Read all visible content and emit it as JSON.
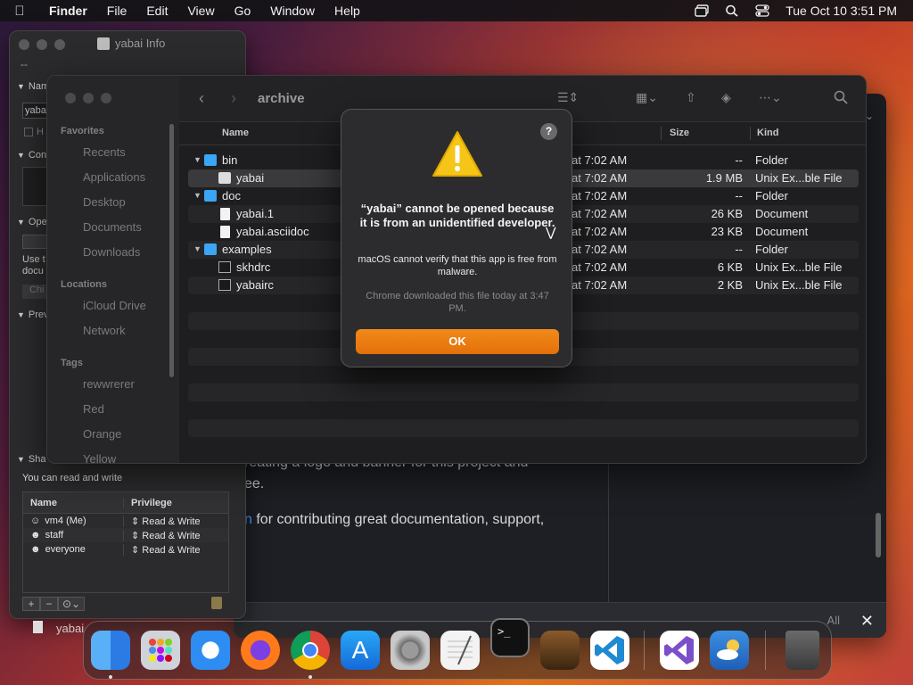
{
  "menubar": {
    "app": "Finder",
    "items": [
      "File",
      "Edit",
      "View",
      "Go",
      "Window",
      "Help"
    ],
    "clock": "Tue Oct 10  3:51 PM"
  },
  "doc_window": {
    "line1": "reating a logo and banner for this project and",
    "line2": "ee.",
    "line3_link": "n",
    "line3_text": " for contributing great documentation, support,",
    "all_label": "All"
  },
  "info_window": {
    "title": "yabai Info",
    "dash": "--",
    "sections": [
      "Nam",
      "yaba",
      "H",
      "Con",
      "Ope",
      "Use t",
      "docu",
      "Chi",
      "Prev",
      "Sha"
    ],
    "share_text": "You can read and write",
    "perm_headers": [
      "Name",
      "Privilege"
    ],
    "permissions": [
      {
        "name": "vm4 (Me)",
        "privilege": "Read & Write"
      },
      {
        "name": "staff",
        "privilege": "Read & Write"
      },
      {
        "name": "everyone",
        "privilege": "Read & Write"
      }
    ]
  },
  "finder": {
    "folder": "archive",
    "sidebar": {
      "favorites_label": "Favorites",
      "favorites": [
        "Recents",
        "Applications",
        "Desktop",
        "Documents",
        "Downloads"
      ],
      "locations_label": "Locations",
      "locations": [
        "iCloud Drive",
        "Network"
      ],
      "tags_label": "Tags",
      "tags": [
        "rewwrerer",
        "Red",
        "Orange",
        "Yellow"
      ]
    },
    "columns": [
      "Name",
      "Size",
      "Kind"
    ],
    "rows": [
      {
        "name": "bin",
        "date": "at 7:02 AM",
        "size": "--",
        "kind": "Folder"
      },
      {
        "name": "yabai",
        "date": "at 7:02 AM",
        "size": "1.9 MB",
        "kind": "Unix Ex...ble File"
      },
      {
        "name": "doc",
        "date": "at 7:02 AM",
        "size": "--",
        "kind": "Folder"
      },
      {
        "name": "yabai.1",
        "date": "at 7:02 AM",
        "size": "26 KB",
        "kind": "Document"
      },
      {
        "name": "yabai.asciidoc",
        "date": "at 7:02 AM",
        "size": "23 KB",
        "kind": "Document"
      },
      {
        "name": "examples",
        "date": "at 7:02 AM",
        "size": "--",
        "kind": "Folder"
      },
      {
        "name": "skhdrc",
        "date": "at 7:02 AM",
        "size": "6 KB",
        "kind": "Unix Ex...ble File"
      },
      {
        "name": "yabairc",
        "date": "at 7:02 AM",
        "size": "2 KB",
        "kind": "Unix Ex...ble File"
      }
    ]
  },
  "alert": {
    "heading": "“yabai” cannot be opened because it is from an unidentified developer.",
    "message": "macOS cannot verify that this app is free from malware.",
    "sub": "Chrome downloaded this file today at 3:47 PM.",
    "ok_label": "OK",
    "help": "?"
  },
  "dock": {
    "behind_label": "yabai",
    "apps": [
      "Finder",
      "Launchpad",
      "Safari",
      "Firefox",
      "Chrome",
      "App Store",
      "System Settings",
      "TextEdit",
      "Terminal",
      "GarageBand",
      "Visual Studio Code",
      "Visual Studio",
      "Weather",
      "Trash"
    ]
  },
  "colors": {
    "accent": "#e4700a",
    "folder": "#3aa6f5",
    "link": "#4c9bff"
  }
}
